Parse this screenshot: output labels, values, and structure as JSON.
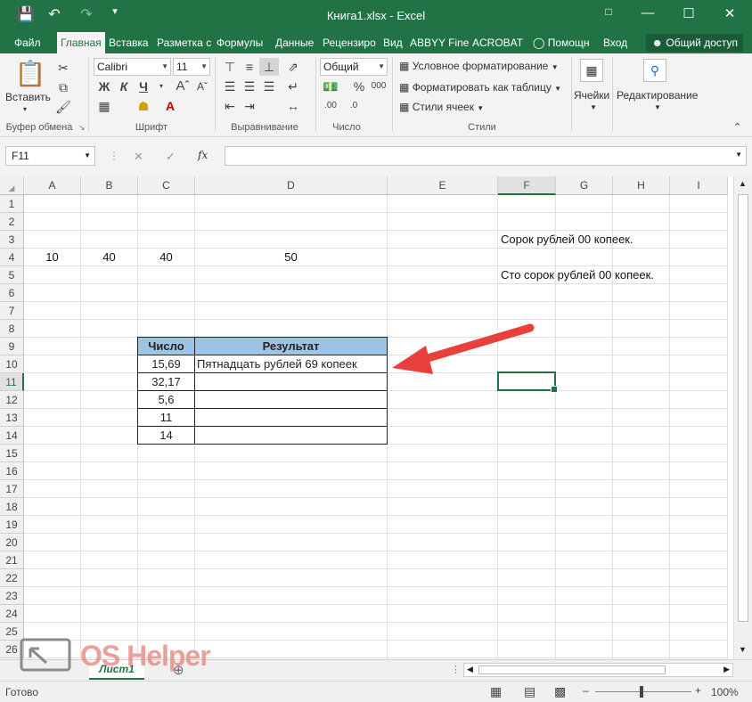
{
  "window": {
    "title": "Книга1.xlsx - Excel",
    "controls": [
      "minimize-icon",
      "restore-icon",
      "close-icon"
    ]
  },
  "tabs": [
    "Файл",
    "Главная",
    "Вставка",
    "Разметка с",
    "Формулы",
    "Данные",
    "Рецензиро",
    "Вид",
    "ABBYY Fine",
    "ACROBAT"
  ],
  "tab_extras": {
    "help": "Помощн",
    "signin": "Вход",
    "share": "Общий доступ"
  },
  "ribbon": {
    "paste": "Вставить",
    "clipboard_label": "Буфер обмена",
    "font_name": "Calibri",
    "font_size": "11",
    "bold": "Ж",
    "italic": "К",
    "underline": "Ч",
    "font_label": "Шрифт",
    "align_label": "Выравнивание",
    "number_format": "Общий",
    "number_label": "Число",
    "cond_format": "Условное форматирование",
    "format_table": "Форматировать как таблицу",
    "cell_styles": "Стили ячеек",
    "styles_label": "Стили",
    "cells": "Ячейки",
    "editing": "Редактирование"
  },
  "formula_bar": {
    "name_box": "F11",
    "fx": "fx",
    "formula": ""
  },
  "grid": {
    "columns": [
      "A",
      "B",
      "C",
      "D",
      "E",
      "F",
      "G",
      "H",
      "I"
    ],
    "rows": [
      "1",
      "2",
      "3",
      "4",
      "5",
      "6",
      "7",
      "8",
      "9",
      "10",
      "11",
      "12",
      "13",
      "14",
      "15",
      "16",
      "17",
      "18",
      "19",
      "20",
      "21",
      "22",
      "23",
      "24",
      "25",
      "26"
    ],
    "selected_cell": "F11",
    "cells": {
      "A4": "10",
      "B4": "40",
      "C4": "40",
      "D4": "50",
      "F3": "Сорок рублей  00 копеек.",
      "F5": "Сто сорок рублей  00 копеек."
    },
    "table": {
      "headers": [
        "Число",
        "Результат"
      ],
      "rows": [
        [
          "15,69",
          "Пятнадцать рублей 69 копеек"
        ],
        [
          "32,17",
          ""
        ],
        [
          "5,6",
          ""
        ],
        [
          "11",
          ""
        ],
        [
          "14",
          ""
        ]
      ]
    }
  },
  "sheets": {
    "active": "Лист1"
  },
  "status": {
    "ready": "Готово",
    "zoom": "100%"
  },
  "watermark": {
    "text": "OS Helper"
  },
  "colors": {
    "excel_green": "#217346",
    "table_header": "#9dc3e6",
    "arrow": "#e8413c"
  }
}
